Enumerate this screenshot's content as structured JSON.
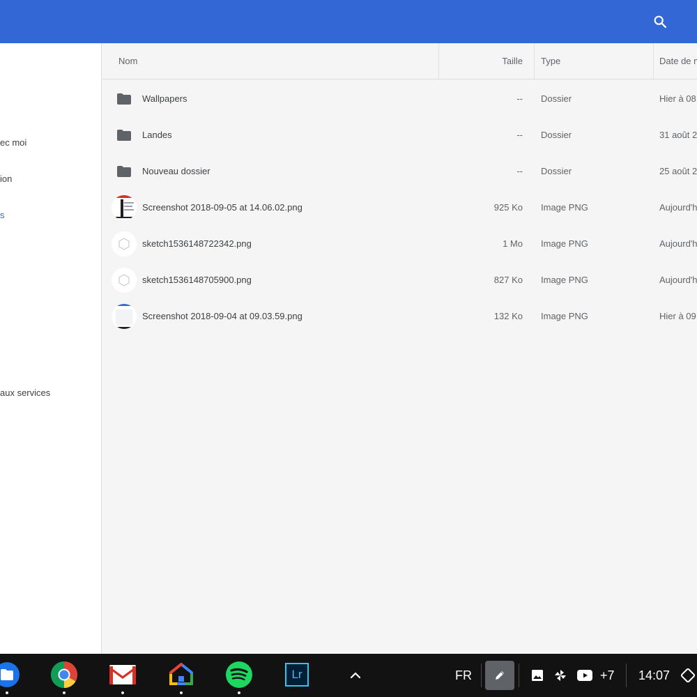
{
  "header": {
    "search_icon": "search-icon",
    "color": "#3367d6"
  },
  "sidebar": {
    "items": [
      {
        "label": "ec moi"
      },
      {
        "label": "ion"
      },
      {
        "label": "s",
        "active": true
      },
      {
        "label": "aux services"
      }
    ]
  },
  "table": {
    "columns": {
      "name": "Nom",
      "size": "Taille",
      "type": "Type",
      "date": "Date de m"
    },
    "rows": [
      {
        "icon": "folder-icon",
        "name": "Wallpapers",
        "size": "--",
        "type": "Dossier",
        "date": "Hier à 08:"
      },
      {
        "icon": "folder-icon",
        "name": "Landes",
        "size": "--",
        "type": "Dossier",
        "date": "31 août 2"
      },
      {
        "icon": "folder-icon",
        "name": "Nouveau dossier",
        "size": "--",
        "type": "Dossier",
        "date": "25 août 2"
      },
      {
        "icon": "image-thumbnail",
        "name": "Screenshot 2018-09-05 at 14.06.02.png",
        "size": "925 Ko",
        "type": "Image PNG",
        "date": "Aujourd'h"
      },
      {
        "icon": "sketch-thumbnail",
        "name": "sketch1536148722342.png",
        "size": "1 Mo",
        "type": "Image PNG",
        "date": "Aujourd'h"
      },
      {
        "icon": "sketch-thumbnail",
        "name": "sketch1536148705900.png",
        "size": "827 Ko",
        "type": "Image PNG",
        "date": "Aujourd'h"
      },
      {
        "icon": "image-thumbnail",
        "name": "Screenshot 2018-09-04 at 09.03.59.png",
        "size": "132 Ko",
        "type": "Image PNG",
        "date": "Hier à 09:"
      }
    ]
  },
  "shelf": {
    "apps": [
      {
        "name": "files-app-icon"
      },
      {
        "name": "chrome-app-icon"
      },
      {
        "name": "gmail-app-icon"
      },
      {
        "name": "google-home-app-icon"
      },
      {
        "name": "spotify-app-icon"
      },
      {
        "name": "lightroom-app-icon",
        "label": "Lr"
      }
    ],
    "tray": {
      "language": "FR",
      "more_count": "+7",
      "time": "14:07"
    }
  }
}
